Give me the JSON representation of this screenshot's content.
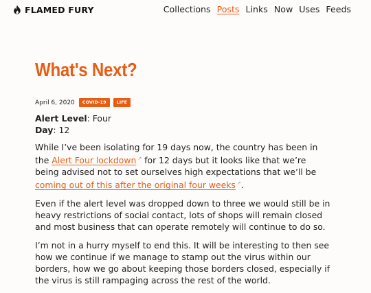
{
  "site": {
    "name": "FLAMED FURY",
    "logo_icon": "flame-icon"
  },
  "nav": {
    "collections": "Collections",
    "posts": "Posts",
    "links": "Links",
    "now": "Now",
    "uses": "Uses",
    "feeds": "Feeds",
    "active": "Posts"
  },
  "post": {
    "title": "What's Next?",
    "date": "April 6, 2020",
    "tags": [
      "COVID-19",
      "LIFE"
    ],
    "alert_label": "Alert Level",
    "alert_value": ": Four",
    "day_label": "Day",
    "day_value": ": 12",
    "p1": {
      "t1": "While I’ve been isolating for 19 days now, the country has been in the ",
      "link1": "Alert Four lockdown",
      "t2": " for 12 days but it looks like that we’re being advised not to set ourselves high expectations that we’ll be ",
      "link2": "coming out of this after the original four weeks",
      "t3": "."
    },
    "p2": "Even if the alert level was dropped down to three we would still be in heavy restrictions of social contact, lots of shops will remain closed and most business that can operate remotely will continue to do so.",
    "p3": "I’m not in a hurry myself to end this. It will be interesting to then see how we continue if we manage to stamp out the virus within our borders, how we go about keeping those borders closed, especially if the virus is still rampaging across the rest of the world.",
    "external_icon": "external-link-icon"
  },
  "colors": {
    "accent": "#e85d14",
    "text": "#222222",
    "background": "#fdfcfb"
  }
}
